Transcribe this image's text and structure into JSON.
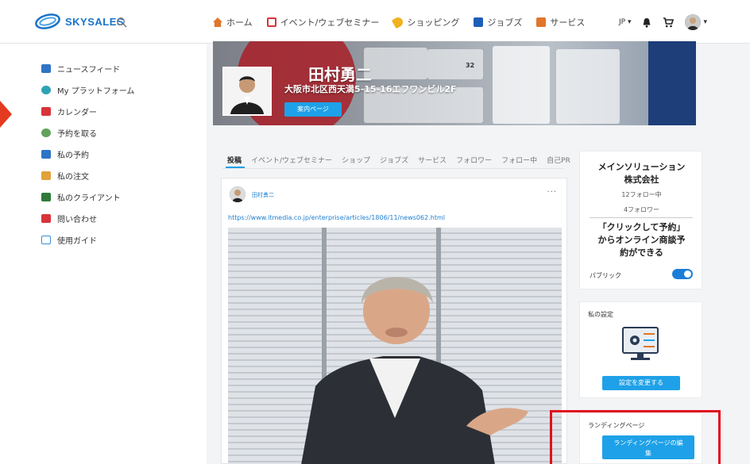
{
  "header": {
    "logo_text": "SKYSALES",
    "nav": [
      {
        "label": "ホーム",
        "icon": "home-icon",
        "color": "#e0762a"
      },
      {
        "label": "イベント/ウェブセミナー",
        "icon": "calendar-icon",
        "color": "#d8343a"
      },
      {
        "label": "ショッピング",
        "icon": "tag-icon",
        "color": "#f0b21e"
      },
      {
        "label": "ジョブズ",
        "icon": "briefcase-icon",
        "color": "#1d5fb8"
      },
      {
        "label": "サービス",
        "icon": "toolbox-icon",
        "color": "#e0762a"
      }
    ],
    "lang": "JP ▾",
    "bell_icon": "bell-icon",
    "cart_icon": "cart-icon",
    "caret": "▾"
  },
  "sidebar": {
    "items": [
      {
        "label": "ニュースフィード",
        "color": "#2f74c6"
      },
      {
        "label": "My プラットフォーム",
        "color": "#2fa3b6"
      },
      {
        "label": "カレンダー",
        "color": "#d8343a"
      },
      {
        "label": "予約を取る",
        "color": "#5fa35b"
      },
      {
        "label": "私の予約",
        "color": "#2f74c6"
      },
      {
        "label": "私の注文",
        "color": "#e0a23a"
      },
      {
        "label": "私のクライアント",
        "color": "#2f7a3a"
      },
      {
        "label": "問い合わせ",
        "color": "#d8343a"
      },
      {
        "label": "使用ガイド",
        "color": "#3a8fd6"
      }
    ]
  },
  "banner": {
    "name": "田村勇二",
    "address": "大阪市北区西天満5-15-16エフワンビル2F",
    "button": "案内ページ",
    "bg_number": "32"
  },
  "tabs": [
    "投稿",
    "イベント/ウェブセミナー",
    "ショップ",
    "ジョブズ",
    "サービス",
    "フォロワー",
    "フォロー中",
    "自己PR"
  ],
  "post": {
    "author": "田村勇二",
    "more": "···",
    "link": "https://www.itmedia.co.jp/enterprise/articles/1806/11/news062.html"
  },
  "company": {
    "name_line1": "メインソリューション",
    "name_line2": "株式会社",
    "following": "12フォロー中",
    "followers": "4フォロワー",
    "promo_line1": "「クリックして予約」",
    "promo_line2": "からオンライン商談予",
    "promo_line3": "約ができる",
    "public_label": "パブリック"
  },
  "settings": {
    "title": "私の設定",
    "button": "設定を変更する"
  },
  "landing": {
    "title": "ランディングページ",
    "button_line1": "ランディングページの編",
    "button_line2": "集"
  }
}
